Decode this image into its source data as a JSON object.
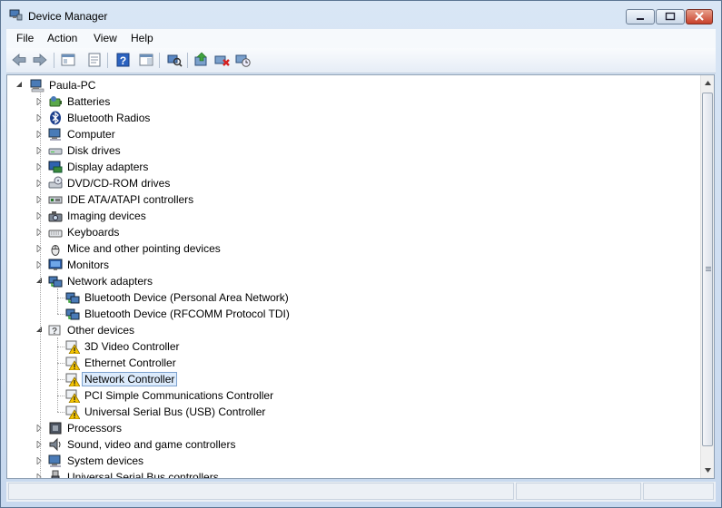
{
  "window": {
    "title": "Device Manager"
  },
  "menu": [
    "File",
    "Action",
    "View",
    "Help"
  ],
  "toolbar": [
    "back-icon",
    "forward-icon",
    "up-tree-icon",
    "properties-icon",
    "help-icon",
    "show-hide-pane-icon",
    "scan-hardware-icon",
    "update-driver-icon",
    "uninstall-icon",
    "disable-icon"
  ],
  "tree": {
    "root": "Paula-PC",
    "nodes": [
      {
        "label": "Batteries",
        "level": 1,
        "expand": "collapsed",
        "icon": "battery-icon"
      },
      {
        "label": "Bluetooth Radios",
        "level": 1,
        "expand": "collapsed",
        "icon": "bluetooth-icon"
      },
      {
        "label": "Computer",
        "level": 1,
        "expand": "collapsed",
        "icon": "computer-icon"
      },
      {
        "label": "Disk drives",
        "level": 1,
        "expand": "collapsed",
        "icon": "disk-drive-icon"
      },
      {
        "label": "Display adapters",
        "level": 1,
        "expand": "collapsed",
        "icon": "display-adapter-icon"
      },
      {
        "label": "DVD/CD-ROM drives",
        "level": 1,
        "expand": "collapsed",
        "icon": "dvd-drive-icon"
      },
      {
        "label": "IDE ATA/ATAPI controllers",
        "level": 1,
        "expand": "collapsed",
        "icon": "ide-controller-icon"
      },
      {
        "label": "Imaging devices",
        "level": 1,
        "expand": "collapsed",
        "icon": "imaging-device-icon"
      },
      {
        "label": "Keyboards",
        "level": 1,
        "expand": "collapsed",
        "icon": "keyboard-icon"
      },
      {
        "label": "Mice and other pointing devices",
        "level": 1,
        "expand": "collapsed",
        "icon": "mouse-icon"
      },
      {
        "label": "Monitors",
        "level": 1,
        "expand": "collapsed",
        "icon": "monitor-icon"
      },
      {
        "label": "Network adapters",
        "level": 1,
        "expand": "expanded",
        "icon": "network-adapter-icon"
      },
      {
        "label": "Bluetooth Device (Personal Area Network)",
        "level": 2,
        "expand": "none",
        "icon": "network-adapter-icon"
      },
      {
        "label": "Bluetooth Device (RFCOMM Protocol TDI)",
        "level": 2,
        "expand": "none",
        "icon": "network-adapter-icon"
      },
      {
        "label": "Other devices",
        "level": 1,
        "expand": "expanded",
        "icon": "unknown-device-icon"
      },
      {
        "label": "3D Video Controller",
        "level": 2,
        "expand": "none",
        "icon": "warning-device-icon"
      },
      {
        "label": "Ethernet Controller",
        "level": 2,
        "expand": "none",
        "icon": "warning-device-icon"
      },
      {
        "label": "Network Controller",
        "level": 2,
        "expand": "none",
        "icon": "warning-device-icon",
        "selected": true
      },
      {
        "label": "PCI Simple Communications Controller",
        "level": 2,
        "expand": "none",
        "icon": "warning-device-icon"
      },
      {
        "label": "Universal Serial Bus (USB) Controller",
        "level": 2,
        "expand": "none",
        "icon": "warning-device-icon"
      },
      {
        "label": "Processors",
        "level": 1,
        "expand": "collapsed",
        "icon": "processor-icon"
      },
      {
        "label": "Sound, video and game controllers",
        "level": 1,
        "expand": "collapsed",
        "icon": "sound-icon"
      },
      {
        "label": "System devices",
        "level": 1,
        "expand": "collapsed",
        "icon": "system-device-icon"
      },
      {
        "label": "Universal Serial Bus controllers",
        "level": 1,
        "expand": "collapsed",
        "icon": "usb-icon"
      }
    ]
  },
  "colors": {
    "selection_bg": "#dcebfc",
    "selection_border": "#7da2ce",
    "warning": "#f5c400",
    "close_button": "#c8412b"
  }
}
